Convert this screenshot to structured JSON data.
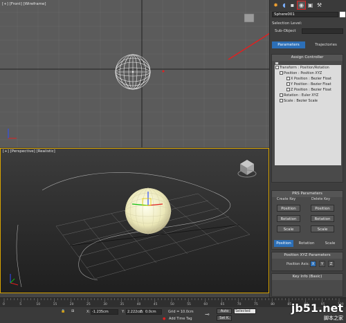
{
  "viewports": {
    "front_label": "[+] [Front] [Wireframe]",
    "perspective_label": "[+] [Perspective] [Realistic]"
  },
  "command_panel": {
    "tab_icons": [
      "create-icon",
      "modify-icon",
      "hierarchy-icon",
      "motion-icon",
      "display-icon",
      "utilities-icon"
    ],
    "selected_tab": "motion-icon",
    "object_name": "Sphere001",
    "selection_level_label": "Selection Level:",
    "sub_object_label": "Sub-Object",
    "parameters_button": "Parameters",
    "trajectories_button": "Trajectories",
    "assign_controller": {
      "title": "Assign Controller",
      "tree": [
        "Transform : Position/Rotation",
        "Position : Position XYZ",
        "X Position : Bezier Float",
        "Y Position : Bezier Float",
        "Z Position : Bezier Float",
        "Rotation : Euler XYZ",
        "Scale : Bezier Scale"
      ]
    },
    "prs": {
      "title": "PRS Parameters",
      "create_key_label": "Create Key",
      "delete_key_label": "Delete Key",
      "create_buttons": [
        "Position",
        "Rotation",
        "Scale"
      ],
      "delete_buttons": [
        "Position",
        "Rotation",
        "Scale"
      ],
      "mode_tabs": [
        "Position",
        "Rotation",
        "Scale"
      ]
    },
    "position_xyz": {
      "title": "Position XYZ Parameters",
      "axis_label": "Position Axis:",
      "axes": [
        "X",
        "Y",
        "Z"
      ]
    },
    "key_info_title": "Key Info (Basic)"
  },
  "timeline": {
    "ticks": [
      "0",
      "5",
      "10",
      "15",
      "20",
      "25",
      "30",
      "35",
      "40",
      "45",
      "50",
      "55",
      "60",
      "65",
      "70",
      "75",
      "80",
      "85",
      "90",
      "95",
      "100"
    ]
  },
  "status_bar": {
    "x_label": "X:",
    "x_value": "-1.235cm",
    "y_label": "Y:",
    "y_value": "2.222cm",
    "z_label": "Z:",
    "z_value": "0.0cm",
    "grid_label": "Grid = 10.0cm",
    "add_time_tag": "Add Time Tag",
    "auto_label": "Auto",
    "set_key_label": "Set K.",
    "selected_value": "Selected"
  },
  "watermark": {
    "site": "jb51.net",
    "subtitle": "脚本之家"
  },
  "colors": {
    "accent_blue": "#2c6fb7",
    "highlight_red": "#e02020",
    "viewport_active_border": "#d9a400"
  }
}
